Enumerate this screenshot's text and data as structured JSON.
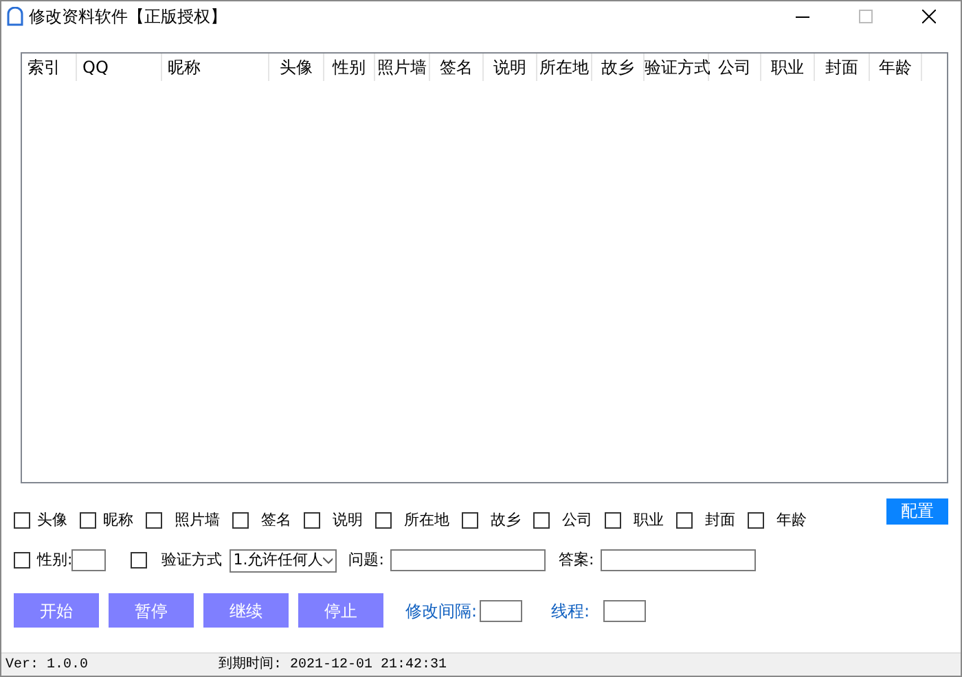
{
  "window": {
    "title": "修改资料软件【正版授权】"
  },
  "table": {
    "columns": [
      "索引",
      "QQ",
      "昵称",
      "头像",
      "性别",
      "照片墙",
      "签名",
      "说明",
      "所在地",
      "故乡",
      "验证方式",
      "公司",
      "职业",
      "封面",
      "年龄"
    ]
  },
  "fields": [
    {
      "label": "头像",
      "checked": false
    },
    {
      "label": "昵称",
      "checked": false
    },
    {
      "label": "照片墙",
      "checked": false
    },
    {
      "label": "签名",
      "checked": false
    },
    {
      "label": "说明",
      "checked": false
    },
    {
      "label": "所在地",
      "checked": false
    },
    {
      "label": "故乡",
      "checked": false
    },
    {
      "label": "公司",
      "checked": false
    },
    {
      "label": "职业",
      "checked": false
    },
    {
      "label": "封面",
      "checked": false
    },
    {
      "label": "年龄",
      "checked": false
    }
  ],
  "config_button": "配置",
  "gender": {
    "label": "性别:",
    "checked": false
  },
  "verify": {
    "label": "验证方式",
    "checked": false,
    "value": "1.允许任何人"
  },
  "question": {
    "label": "问题:"
  },
  "answer": {
    "label": "答案:"
  },
  "buttons": [
    "开始",
    "暂停",
    "继续",
    "停止"
  ],
  "interval": {
    "label": "修改间隔:"
  },
  "threads": {
    "label": "线程:"
  },
  "status_bar": {
    "version": "Ver: 1.0.0",
    "expiry": "到期时间: 2021-12-01 21:42:31"
  }
}
